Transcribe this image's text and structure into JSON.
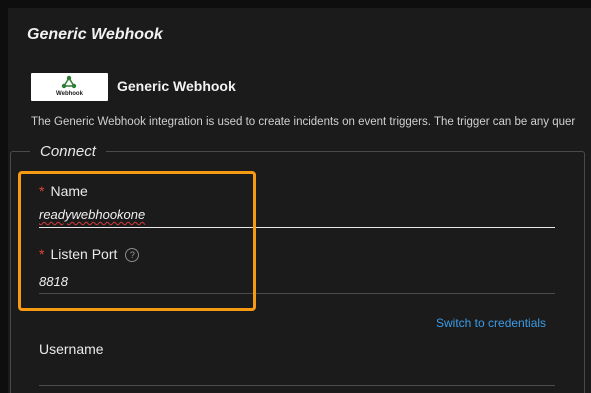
{
  "dialog": {
    "title": "Generic Webhook"
  },
  "integration": {
    "logo_text": "Webhook",
    "name": "Generic Webhook",
    "description": "The Generic Webhook integration is used to create incidents on event triggers. The trigger can be any quer"
  },
  "connect": {
    "legend": "Connect",
    "name_field": {
      "required_mark": "*",
      "label": "Name",
      "value": "readywebhookone"
    },
    "port_field": {
      "required_mark": "*",
      "label": "Listen Port",
      "help_glyph": "?",
      "value": "8818"
    },
    "switch_link": "Switch to credentials",
    "username_field": {
      "label": "Username",
      "value": ""
    }
  },
  "colors": {
    "highlight": "#f59a12",
    "link": "#3c9ce8",
    "required": "#e0463c",
    "logo_green": "#2e7d32"
  },
  "icons": {
    "logo": "webhook-icon",
    "help": "question-circle-icon"
  }
}
